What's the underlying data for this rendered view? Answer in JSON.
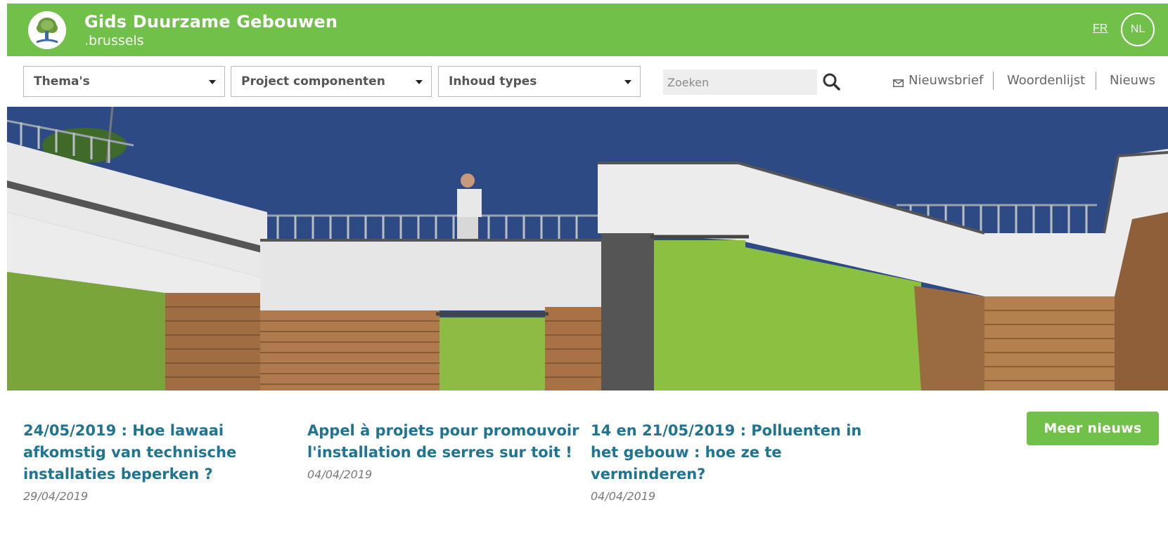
{
  "header": {
    "title": "Gids Duurzame Gebouwen",
    "subtitle": ".brussels",
    "logo_icon": "tree-logo-icon",
    "lang_fr": "FR",
    "lang_nl": "NL",
    "brand_color": "#71c04a"
  },
  "toolbar": {
    "dropdowns": [
      {
        "label": "Thema's"
      },
      {
        "label": "Project componenten"
      },
      {
        "label": "Inhoud types"
      }
    ],
    "search": {
      "placeholder": "Zoeken",
      "value": "",
      "icon": "search-icon"
    },
    "links": {
      "newsletter": "Nieuwsbrief",
      "newsletter_icon": "mail-icon",
      "glossary": "Woordenlijst",
      "news": "Nieuws"
    }
  },
  "news": {
    "items": [
      {
        "title": "24/05/2019 : Hoe lawaai afkomstig van technische installaties beperken ?",
        "date": "29/04/2019"
      },
      {
        "title": "Appel à projets pour promouvoir l'installation de serres sur toit !",
        "date": "04/04/2019"
      },
      {
        "title": "14 en 21/05/2019 : Polluenten in het gebouw : hoe ze te verminderen?",
        "date": "04/04/2019"
      }
    ],
    "more_button": "Meer nieuws",
    "title_color": "#1f7492"
  }
}
